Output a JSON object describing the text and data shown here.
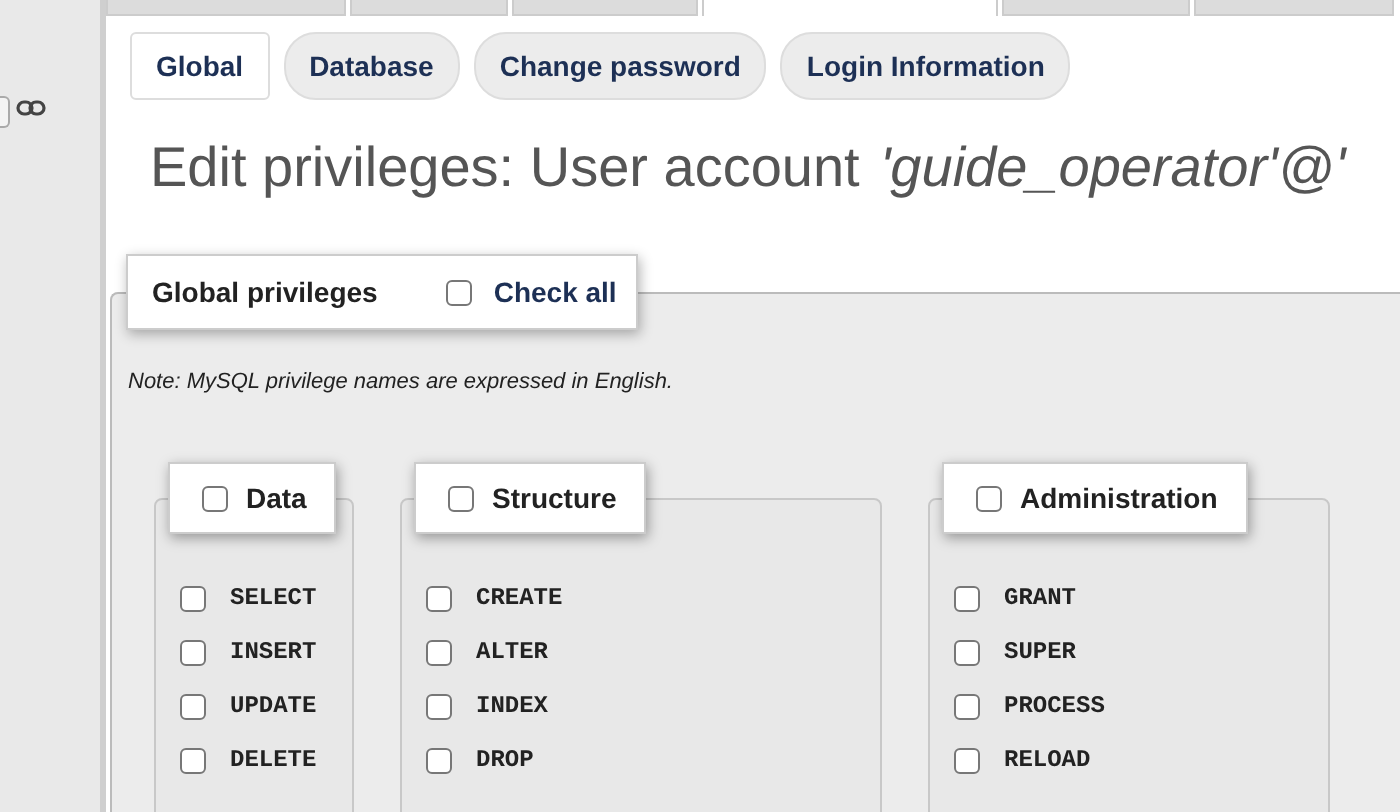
{
  "top_tabs": [
    {
      "selected": false
    },
    {
      "selected": false
    },
    {
      "selected": false
    },
    {
      "selected": true
    },
    {
      "selected": false
    },
    {
      "selected": false
    }
  ],
  "subtabs": [
    {
      "label": "Global",
      "selected": true
    },
    {
      "label": "Database",
      "selected": false
    },
    {
      "label": "Change password",
      "selected": false
    },
    {
      "label": "Login Information",
      "selected": false
    }
  ],
  "heading": {
    "text": "Edit privileges: User account",
    "account": "'guide_operator'@'"
  },
  "global_privileges": {
    "legend": "Global privileges",
    "check_all": {
      "label": "Check all",
      "checked": false
    },
    "note": "Note: MySQL privilege names are expressed in English.",
    "groups": [
      {
        "label": "Data",
        "checked": false,
        "items": [
          {
            "label": "SELECT",
            "checked": false
          },
          {
            "label": "INSERT",
            "checked": false
          },
          {
            "label": "UPDATE",
            "checked": false
          },
          {
            "label": "DELETE",
            "checked": false
          }
        ]
      },
      {
        "label": "Structure",
        "checked": false,
        "items": [
          {
            "label": "CREATE",
            "checked": false
          },
          {
            "label": "ALTER",
            "checked": false
          },
          {
            "label": "INDEX",
            "checked": false
          },
          {
            "label": "DROP",
            "checked": false
          }
        ]
      },
      {
        "label": "Administration",
        "checked": false,
        "items": [
          {
            "label": "GRANT",
            "checked": false
          },
          {
            "label": "SUPER",
            "checked": false
          },
          {
            "label": "PROCESS",
            "checked": false
          },
          {
            "label": "RELOAD",
            "checked": false
          }
        ]
      }
    ]
  }
}
